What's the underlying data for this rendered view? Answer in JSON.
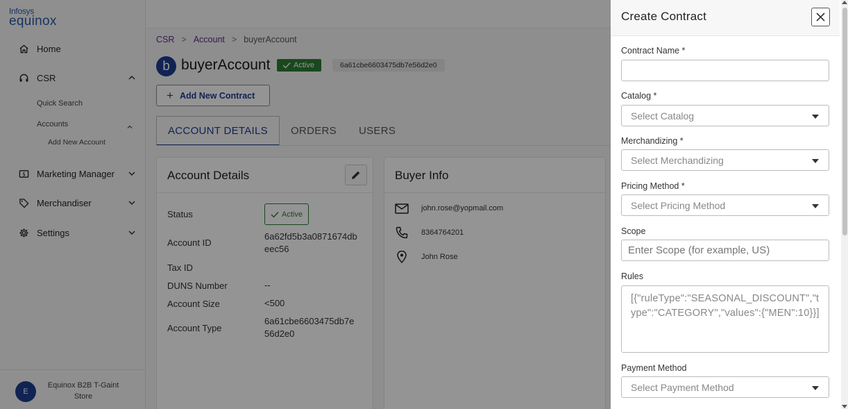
{
  "logo": {
    "line1": "Infosys",
    "line2": "equinox"
  },
  "sidebar": {
    "items": [
      {
        "label": "Home",
        "icon": "home-icon"
      },
      {
        "label": "CSR",
        "icon": "headset-icon",
        "expanded": true
      },
      {
        "label": "Marketing Manager",
        "icon": "dollar-icon"
      },
      {
        "label": "Merchandiser",
        "icon": "tag-icon"
      },
      {
        "label": "Settings",
        "icon": "gear-icon"
      }
    ],
    "csr_sub": {
      "quick_search": "Quick Search",
      "accounts": "Accounts",
      "add_new_account": "Add New Account"
    },
    "footer": {
      "avatar": "E",
      "store_line1": "Equinox B2B T-Gaint",
      "store_line2": "Store"
    }
  },
  "breadcrumb": {
    "items": [
      "CSR",
      "Account",
      "buyerAccount"
    ],
    "separator": ">"
  },
  "account": {
    "badge": "b",
    "name": "buyerAccount",
    "status": "Active",
    "id": "6a61cbe6603475db7e56d2e0"
  },
  "add_contract_label": "Add New Contract",
  "tabs": [
    "ACCOUNT DETAILS",
    "ORDERS",
    "USERS"
  ],
  "account_details": {
    "title": "Account Details",
    "rows": [
      {
        "label": "Status",
        "value": "Active"
      },
      {
        "label": "Account ID",
        "value": "6a62fd5b3a0871674dbeec56"
      },
      {
        "label": "Tax ID",
        "value": ""
      },
      {
        "label": "DUNS Number",
        "value": "--"
      },
      {
        "label": "Account Size",
        "value": "<500"
      },
      {
        "label": "Account Type",
        "value": "6a61cbe6603475db7e56d2e0"
      }
    ]
  },
  "buyer_info": {
    "title": "Buyer Info",
    "email": "john.rose@yopmail.com",
    "phone": "8364764201",
    "name": "John Rose"
  },
  "drawer": {
    "title": "Create Contract",
    "fields": {
      "contract_name": {
        "label": "Contract Name *",
        "value": ""
      },
      "catalog": {
        "label": "Catalog *",
        "placeholder": "Select Catalog"
      },
      "merchandizing": {
        "label": "Merchandizing *",
        "placeholder": "Select Merchandizing"
      },
      "pricing_method": {
        "label": "Pricing Method *",
        "placeholder": "Select Pricing Method"
      },
      "scope": {
        "label": "Scope",
        "placeholder": "Enter Scope (for example, US)"
      },
      "rules": {
        "label": "Rules",
        "placeholder": "[{\"ruleType\":\"SEASONAL_DISCOUNT\",\"type\":\"CATEGORY\",\"values\":{\"MEN\":10}}]"
      },
      "payment_method": {
        "label": "Payment Method",
        "placeholder": "Select Payment Method"
      }
    }
  },
  "colors": {
    "brand": "#1d3d8f",
    "active": "#2e7d32",
    "link": "#5b2a86"
  }
}
